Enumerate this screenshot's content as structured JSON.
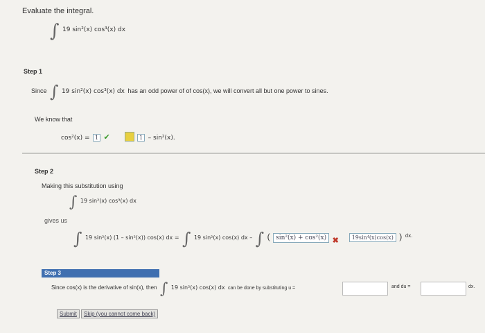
{
  "question": {
    "prompt": "Evaluate the integral.",
    "integral": "19 sin²(x) cos³(x) dx"
  },
  "step1": {
    "title": "Step 1",
    "since": "Since",
    "integral": "19 sin²(x) cos³(x) dx",
    "sentence": "has an odd power of of cos(x), we will convert all but one power to sines.",
    "we_know": "We know that",
    "lhs": "cos²(x) =",
    "answer1": "1",
    "answer2": "1",
    "rhs_tail": "– sin²(x)."
  },
  "step2": {
    "title": "Step 2",
    "making": "Making this substitution using",
    "integral": "19 sin²(x) cos³(x) dx",
    "gives_us": "gives us",
    "expr1": "19 sin²(x) (1 – sin²(x)) cos(x) dx =",
    "expr2": "19 sin²(x) cos(x) dx –",
    "wrong_answer": "sin²(x) + cos²(x)",
    "answer_box": "19sin⁴(x)cos(x)",
    "dx": "dx."
  },
  "step3": {
    "title": "Step 3",
    "sentence_start": "Since cos(x) is the derivative of sin(x), then",
    "integral": "19 sin²(x) cos(x) dx",
    "sentence_mid": "can be done by substituting u =",
    "and_du": "and du =",
    "dx": "dx.",
    "u_value": "",
    "du_value": ""
  },
  "buttons": {
    "submit": "Submit",
    "skip": "Skip (you cannot come back)"
  }
}
